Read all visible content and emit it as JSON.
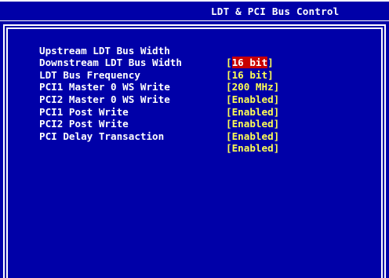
{
  "title": "LDT & PCI Bus Control",
  "settings": [
    {
      "label": "Upstream LDT Bus Width",
      "value": "16 bit",
      "selected": true
    },
    {
      "label": "Downstream LDT Bus Width",
      "value": "16 bit",
      "selected": false
    },
    {
      "label": "LDT Bus Frequency",
      "value": "200 MHz",
      "selected": false
    },
    {
      "label": "PCI1 Master 0 WS Write",
      "value": "Enabled",
      "selected": false
    },
    {
      "label": "PCI2 Master 0 WS Write",
      "value": "Enabled",
      "selected": false
    },
    {
      "label": "PCI1 Post Write",
      "value": "Enabled",
      "selected": false
    },
    {
      "label": "PCI2 Post Write",
      "value": "Enabled",
      "selected": false
    },
    {
      "label": "PCI Delay Transaction",
      "value": "Enabled",
      "selected": false
    }
  ],
  "colors": {
    "background": "#0000a8",
    "label": "#ffffff",
    "value": "#ffff54",
    "highlight": "#c80000"
  }
}
